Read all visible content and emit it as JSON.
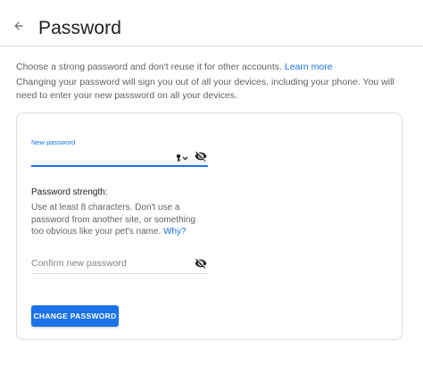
{
  "header": {
    "title": "Password",
    "back_icon": "arrow-left-icon"
  },
  "intro": {
    "line1": "Choose a strong password and don't reuse it for other accounts.",
    "learn_more": "Learn more",
    "line2": "Changing your password will sign you out of all your devices, including your phone. You will need to enter your new password on all your devices."
  },
  "form": {
    "new_password_label": "New password",
    "new_password_value": "",
    "key_icon": "key-dropdown-icon",
    "visibility_icon": "eye-off-icon",
    "strength_title": "Password strength:",
    "strength_text": "Use at least 8 characters. Don't use a password from another site, or something too obvious like your pet's name.",
    "why_link": "Why?",
    "confirm_placeholder": "Confirm new password",
    "confirm_value": "",
    "submit_label": "CHANGE PASSWORD"
  },
  "colors": {
    "accent": "#1a73e8",
    "text_primary": "#202124",
    "text_secondary": "#5f6368",
    "border": "#dadce0"
  }
}
